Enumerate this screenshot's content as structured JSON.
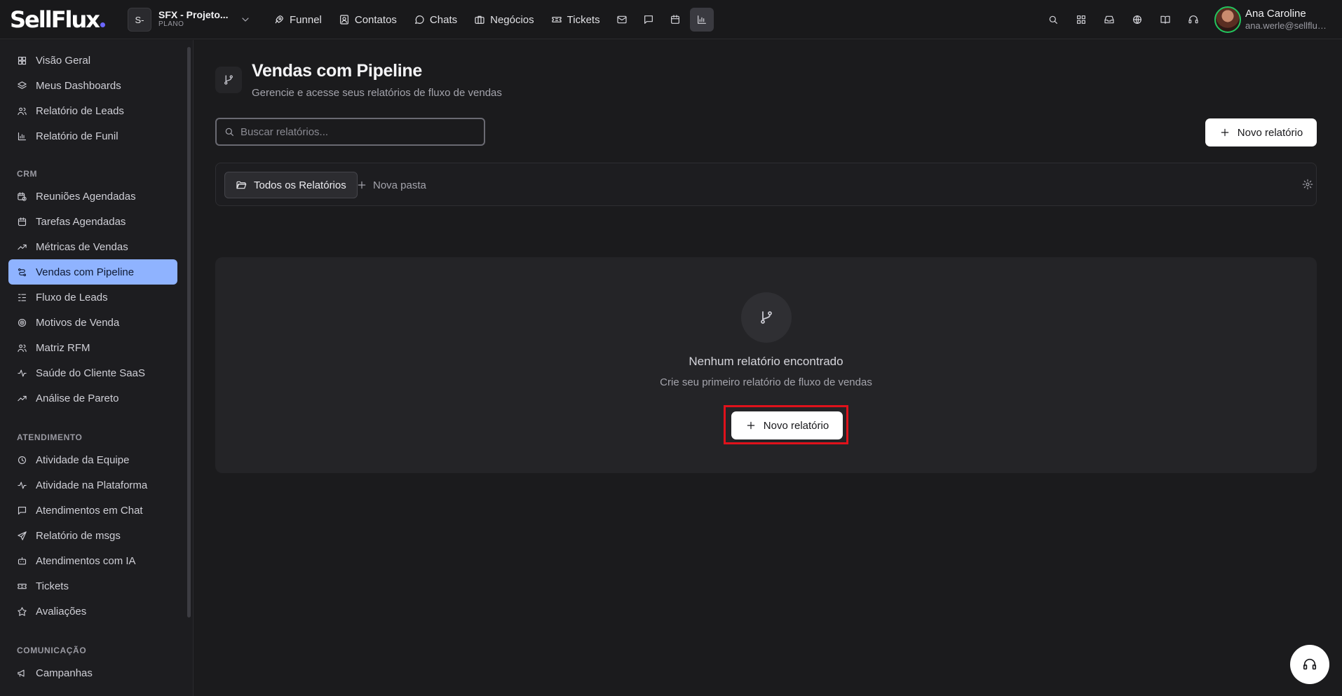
{
  "brand": {
    "logo_text": "SellFlux",
    "accent": "#6b66ff"
  },
  "project": {
    "initial": "S-",
    "name": "SFX - Projeto...",
    "plan": "PLANO"
  },
  "topnav": {
    "items": [
      {
        "label": "Funnel",
        "icon": "rocket-icon"
      },
      {
        "label": "Contatos",
        "icon": "contact-icon"
      },
      {
        "label": "Chats",
        "icon": "chat-icon"
      },
      {
        "label": "Negócios",
        "icon": "briefcase-icon"
      },
      {
        "label": "Tickets",
        "icon": "ticket-icon"
      }
    ],
    "icon_buttons": [
      "mail-icon",
      "message-icon",
      "calendar-icon",
      "bar-chart-icon"
    ],
    "active_icon": "bar-chart-icon"
  },
  "toolbar_right": {
    "icons": [
      "search-icon",
      "apps-grid-icon",
      "inbox-icon",
      "globe-icon",
      "book-icon",
      "headset-icon"
    ]
  },
  "user": {
    "name": "Ana Caroline",
    "email": "ana.werle@sellflux...",
    "status_color": "#22c55e"
  },
  "sidebar": {
    "group1": [
      {
        "label": "Visão Geral",
        "icon": "grid-icon"
      },
      {
        "label": "Meus Dashboards",
        "icon": "layers-icon"
      },
      {
        "label": "Relatório de Leads",
        "icon": "users-icon"
      },
      {
        "label": "Relatório de Funil",
        "icon": "bar-chart-icon"
      }
    ],
    "crm_title": "CRM",
    "crm": [
      {
        "label": "Reuniões Agendadas",
        "icon": "calendar-clock-icon"
      },
      {
        "label": "Tarefas Agendadas",
        "icon": "calendar-icon"
      },
      {
        "label": "Métricas de Vendas",
        "icon": "trending-up-icon"
      },
      {
        "label": "Vendas com Pipeline",
        "icon": "pipeline-icon",
        "active": true
      },
      {
        "label": "Fluxo de Leads",
        "icon": "list-flow-icon"
      },
      {
        "label": "Motivos de Venda",
        "icon": "target-icon"
      },
      {
        "label": "Matriz RFM",
        "icon": "users-icon"
      },
      {
        "label": "Saúde do Cliente SaaS",
        "icon": "activity-icon"
      },
      {
        "label": "Análise de Pareto",
        "icon": "trending-up-icon"
      }
    ],
    "atendimento_title": "ATENDIMENTO",
    "atendimento": [
      {
        "label": "Atividade da Equipe",
        "icon": "clock-icon"
      },
      {
        "label": "Atividade na Plataforma",
        "icon": "activity-icon"
      },
      {
        "label": "Atendimentos em Chat",
        "icon": "message-icon"
      },
      {
        "label": "Relatório de msgs",
        "icon": "send-icon"
      },
      {
        "label": "Atendimentos com IA",
        "icon": "bot-icon"
      },
      {
        "label": "Tickets",
        "icon": "ticket-icon"
      },
      {
        "label": "Avaliações",
        "icon": "star-icon"
      }
    ],
    "comunicacao_title": "COMUNICAÇÃO",
    "comunicacao": [
      {
        "label": "Campanhas",
        "icon": "megaphone-icon"
      }
    ],
    "active_color": "#8fb3ff"
  },
  "page": {
    "title": "Vendas com Pipeline",
    "subtitle": "Gerencie e acesse seus relatórios de fluxo de vendas",
    "search_placeholder": "Buscar relatórios...",
    "new_report_label": "Novo relatório",
    "folder_all": "Todos os Relatórios",
    "new_folder": "Nova pasta"
  },
  "empty_state": {
    "title": "Nenhum relatório encontrado",
    "subtitle": "Crie seu primeiro relatório de fluxo de vendas",
    "button_label": "Novo relatório",
    "highlight_color": "#e0121b"
  }
}
